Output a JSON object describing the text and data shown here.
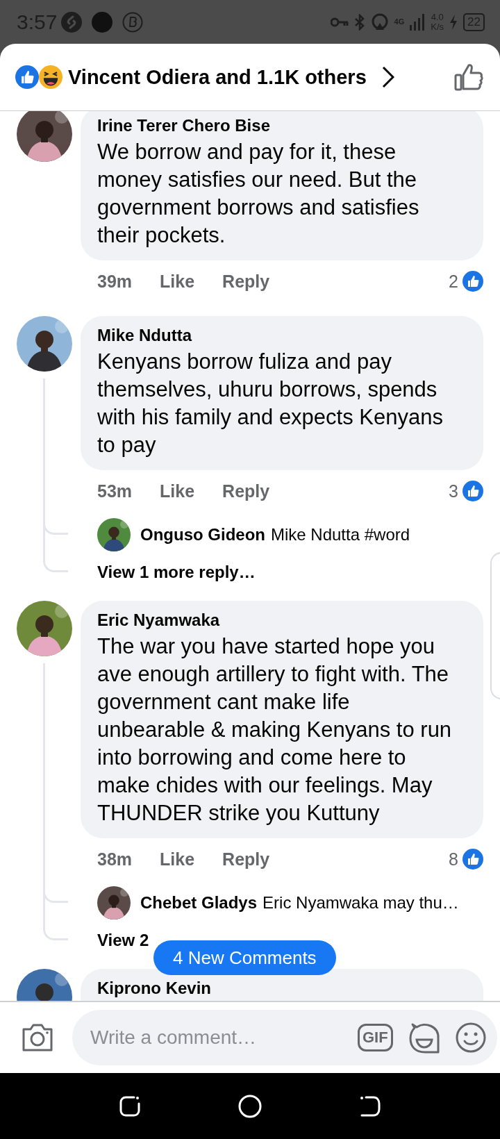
{
  "status_bar": {
    "time": "3:57",
    "network": "4G",
    "speed": "4.0",
    "speed_unit": "K/s",
    "battery": "22"
  },
  "header": {
    "reactors": "Vincent Odiera and 1.1K others"
  },
  "comments": [
    {
      "author": "Irine Terer Chero Bise",
      "text": "We borrow and pay for it, these money satisfies our need. But the government borrows and satisfies their pockets.",
      "time": "39m",
      "like": "Like",
      "reply": "Reply",
      "reactions": "2"
    },
    {
      "author": "Mike Ndutta",
      "text": "Kenyans borrow fuliza and pay themselves,  uhuru borrows, spends with his family and expects Kenyans to pay",
      "time": "53m",
      "like": "Like",
      "reply": "Reply",
      "reactions": "3",
      "replies": [
        {
          "author": "Onguso Gideon",
          "text": "Mike Ndutta #word"
        }
      ],
      "more_replies": "View 1 more reply…"
    },
    {
      "author": "Eric Nyamwaka",
      "text": "The war you have started hope you ave enough artillery to fight with. The government cant make life unbearable & making Kenyans to run into borrowing and come here to make chides with our feelings. May THUNDER strike you Kuttuny",
      "time": "38m",
      "like": "Like",
      "reply": "Reply",
      "reactions": "8",
      "replies": [
        {
          "author": "Chebet Gladys",
          "text": "Eric Nyamwaka may thu…"
        }
      ],
      "more_replies": "View 2"
    },
    {
      "author": "Kiprono Kevin"
    }
  ],
  "new_comments_button": "4 New Comments",
  "composer": {
    "placeholder": "Write a comment…",
    "gif_label": "GIF"
  }
}
